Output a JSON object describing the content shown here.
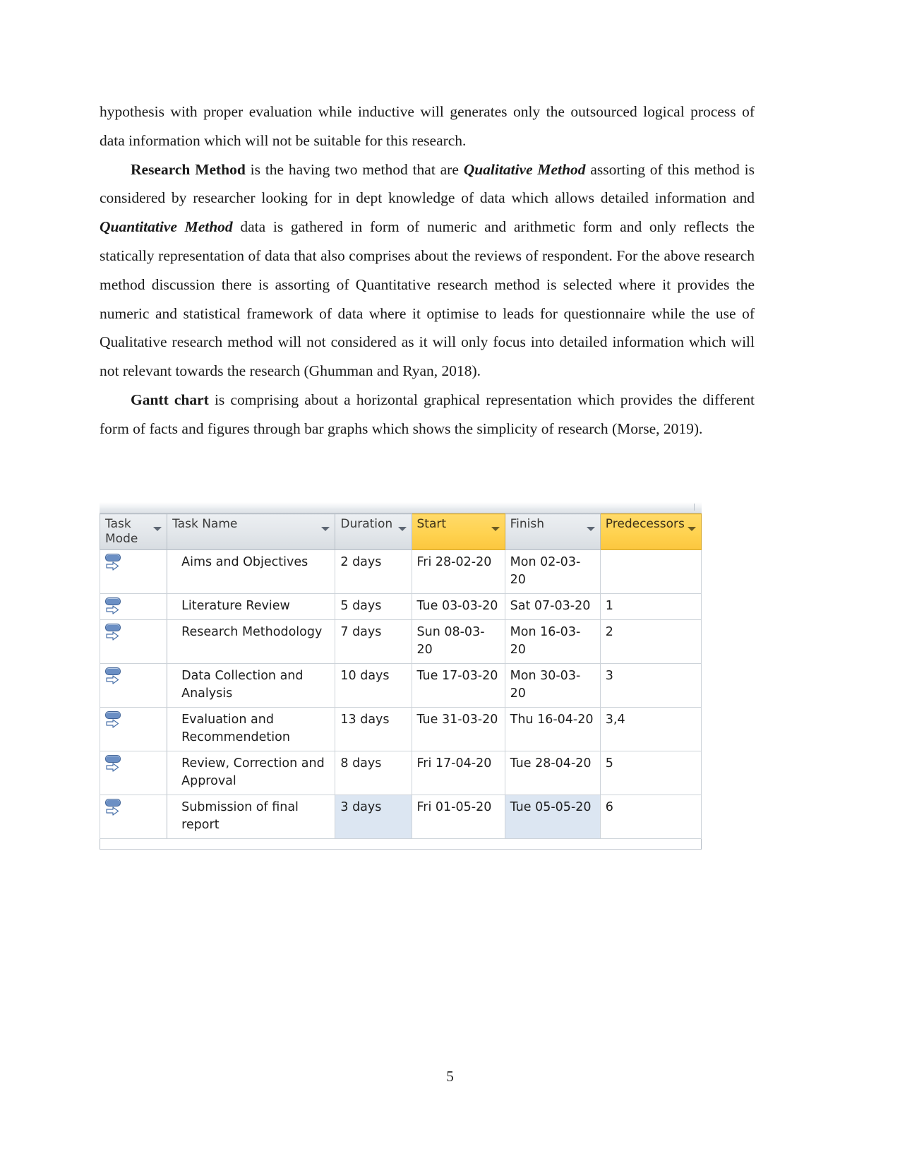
{
  "document": {
    "page_number": "5",
    "paragraphs": [
      {
        "id": "p1",
        "indent": false,
        "runs": [
          {
            "text": "hypothesis with proper evaluation      while inductive will generates only the outsourced logical process of data information which will not be suitable for this research.",
            "style": "normal"
          }
        ]
      },
      {
        "id": "p2",
        "indent": true,
        "runs": [
          {
            "text": "Research Method",
            "style": "bold"
          },
          {
            "text": " is the having two method that are ",
            "style": "normal"
          },
          {
            "text": "Qualitative Method",
            "style": "bold-italic"
          },
          {
            "text": " assorting of  this method is considered by researcher looking for in  dept knowledge of data which allows detailed information and ",
            "style": "normal"
          },
          {
            "text": "Quantitative Method",
            "style": "bold-italic"
          },
          {
            "text": " data is gathered in form of numeric and arithmetic form and only reflects the statically representation of data that also comprises about the reviews of respondent. For the above research method discussion there is assorting of Quantitative research method is selected where it provides the numeric and statistical framework of data where it optimise to leads for questionnaire while the use of Qualitative research method will not considered as it will only focus into detailed information which will not relevant towards the research (Ghumman and Ryan, 2018).",
            "style": "normal"
          }
        ]
      },
      {
        "id": "p3",
        "indent": true,
        "runs": [
          {
            "text": "Gantt chart",
            "style": "bold"
          },
          {
            "text": " is comprising about a horizontal graphical representation which provides the different form of facts and figures through bar graphs which shows the simplicity of research (Morse, 2019).",
            "style": "normal"
          }
        ]
      }
    ]
  },
  "project_table": {
    "colors": {
      "header_default": "#e2e6ea",
      "header_highlight": "#ffd24f",
      "cell_highlight": "#dce6f2",
      "task_mode_icon": "#6b8fc4",
      "grid_line": "#b6bec6"
    },
    "columns": [
      {
        "key": "task_mode",
        "label": "Task Mode",
        "highlight": false,
        "has_filter": true
      },
      {
        "key": "task_name",
        "label": "Task Name",
        "highlight": false,
        "has_filter": true
      },
      {
        "key": "duration",
        "label": "Duration",
        "highlight": false,
        "has_filter": true
      },
      {
        "key": "start",
        "label": "Start",
        "highlight": true,
        "has_filter": true
      },
      {
        "key": "finish",
        "label": "Finish",
        "highlight": false,
        "has_filter": true
      },
      {
        "key": "predecessors",
        "label": "Predecessors",
        "highlight": true,
        "has_filter": true
      }
    ],
    "rows": [
      {
        "task_mode_icon": "auto-scheduled-icon",
        "task_name": "Aims and Objectives",
        "duration": "2 days",
        "start": "Fri 28-02-20",
        "finish": "Mon 02-03-20",
        "predecessors": "",
        "highlight_cells": []
      },
      {
        "task_mode_icon": "auto-scheduled-icon",
        "task_name": "Literature Review",
        "duration": "5 days",
        "start": "Tue 03-03-20",
        "finish": "Sat 07-03-20",
        "predecessors": "1",
        "highlight_cells": []
      },
      {
        "task_mode_icon": "auto-scheduled-icon",
        "task_name": "Research Methodology",
        "duration": "7 days",
        "start": "Sun 08-03-20",
        "finish": "Mon 16-03-20",
        "predecessors": "2",
        "highlight_cells": []
      },
      {
        "task_mode_icon": "auto-scheduled-icon",
        "task_name": "Data Collection and Analysis",
        "duration": "10 days",
        "start": "Tue 17-03-20",
        "finish": "Mon 30-03-20",
        "predecessors": "3",
        "highlight_cells": []
      },
      {
        "task_mode_icon": "auto-scheduled-icon",
        "task_name": "Evaluation and Recommendetion",
        "duration": "13 days",
        "start": "Tue 31-03-20",
        "finish": "Thu 16-04-20",
        "predecessors": "3,4",
        "highlight_cells": []
      },
      {
        "task_mode_icon": "auto-scheduled-icon",
        "task_name": "Review, Correction and Approval",
        "duration": "8 days",
        "start": "Fri 17-04-20",
        "finish": "Tue 28-04-20",
        "predecessors": "5",
        "highlight_cells": []
      },
      {
        "task_mode_icon": "auto-scheduled-icon",
        "task_name": "Submission of final report",
        "duration": "3 days",
        "start": "Fri 01-05-20",
        "finish": "Tue 05-05-20",
        "predecessors": "6",
        "highlight_cells": [
          "duration",
          "finish"
        ]
      }
    ]
  }
}
